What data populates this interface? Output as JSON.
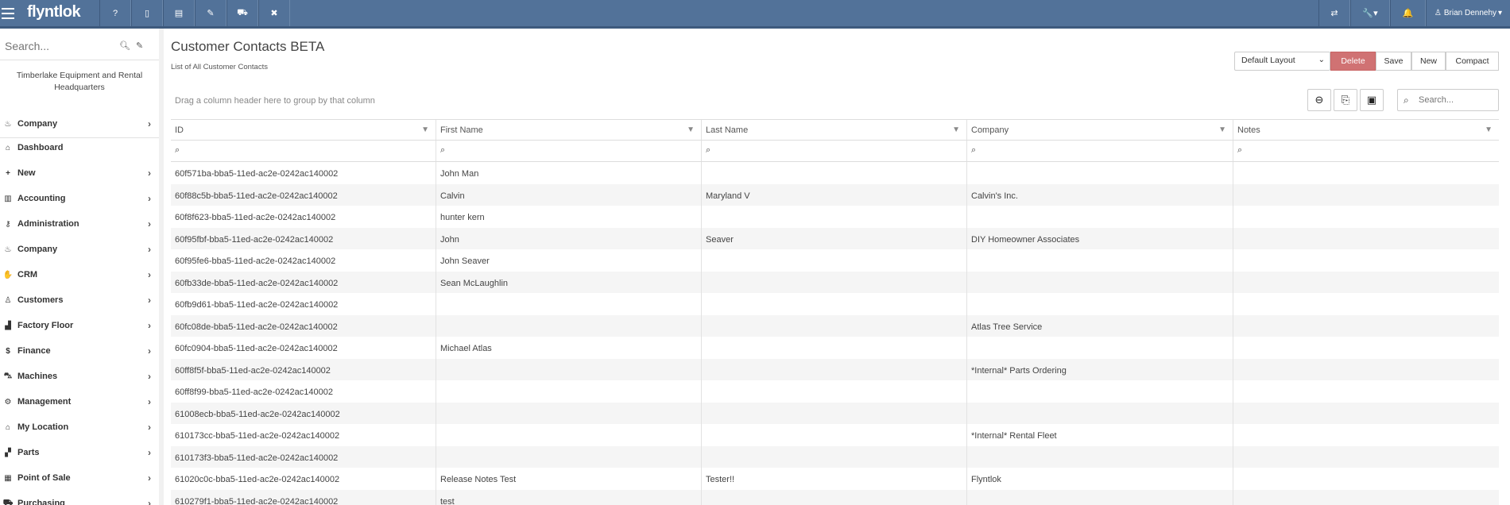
{
  "topbar": {
    "logo": "flyntlok",
    "buttons": [
      {
        "name": "help-icon",
        "glyph": "?"
      },
      {
        "name": "mobile-icon",
        "glyph": "▯"
      },
      {
        "name": "document-icon",
        "glyph": "▤"
      },
      {
        "name": "edit-document-icon",
        "glyph": "✎"
      },
      {
        "name": "cart-icon",
        "glyph": "⛟"
      },
      {
        "name": "tools-icon",
        "glyph": "✖"
      }
    ],
    "right_buttons": [
      {
        "name": "swap-icon",
        "glyph": "⇄"
      },
      {
        "name": "wrench-menu-icon",
        "glyph": "🔧▾"
      },
      {
        "name": "bell-icon",
        "glyph": "🔔"
      }
    ],
    "user_name": "Brian Dennehy"
  },
  "sidebar": {
    "search_placeholder": "Search...",
    "location": "Timberlake Equipment and Rental Headquarters",
    "company_top": "Company",
    "items": [
      {
        "label": "Dashboard",
        "icon": "home-icon",
        "glyph": "⌂",
        "chevron": false
      },
      {
        "label": "New",
        "icon": "plus-icon",
        "glyph": "+",
        "chevron": true
      },
      {
        "label": "Accounting",
        "icon": "bank-icon",
        "glyph": "▥",
        "chevron": true
      },
      {
        "label": "Administration",
        "icon": "key-icon",
        "glyph": "⚷",
        "chevron": true
      },
      {
        "label": "Company",
        "icon": "fire-icon",
        "glyph": "♨",
        "chevron": true
      },
      {
        "label": "CRM",
        "icon": "handshake-icon",
        "glyph": "✋",
        "chevron": true
      },
      {
        "label": "Customers",
        "icon": "person-icon",
        "glyph": "♙",
        "chevron": true
      },
      {
        "label": "Factory Floor",
        "icon": "factory-icon",
        "glyph": "▟",
        "chevron": true
      },
      {
        "label": "Finance",
        "icon": "dollar-icon",
        "glyph": "$",
        "chevron": true
      },
      {
        "label": "Machines",
        "icon": "tractor-icon",
        "glyph": "⛍",
        "chevron": true
      },
      {
        "label": "Management",
        "icon": "cog-icon",
        "glyph": "⚙",
        "chevron": true
      },
      {
        "label": "My Location",
        "icon": "home-icon",
        "glyph": "⌂",
        "chevron": true
      },
      {
        "label": "Parts",
        "icon": "boxes-icon",
        "glyph": "▞",
        "chevron": true
      },
      {
        "label": "Point of Sale",
        "icon": "register-icon",
        "glyph": "▦",
        "chevron": true
      },
      {
        "label": "Purchasing",
        "icon": "cart-icon",
        "glyph": "⛟",
        "chevron": true
      }
    ]
  },
  "main": {
    "title": "Customer Contacts BETA",
    "subtitle": "List of All Customer Contacts",
    "layout_select": "Default Layout",
    "buttons": {
      "delete": "Delete",
      "save": "Save",
      "new": "New",
      "compact": "Compact"
    },
    "group_hint": "Drag a column header here to group by that column",
    "grid_search_placeholder": "Search..."
  },
  "grid": {
    "columns": [
      "ID",
      "First Name",
      "Last Name",
      "Company",
      "Notes"
    ],
    "rows": [
      [
        "60f571ba-bba5-11ed-ac2e-0242ac140002",
        "John Man",
        "",
        "",
        ""
      ],
      [
        "60f88c5b-bba5-11ed-ac2e-0242ac140002",
        "Calvin",
        "Maryland V",
        "Calvin's Inc.",
        ""
      ],
      [
        "60f8f623-bba5-11ed-ac2e-0242ac140002",
        "hunter kern",
        "",
        "",
        ""
      ],
      [
        "60f95fbf-bba5-11ed-ac2e-0242ac140002",
        "John",
        "Seaver",
        "DIY Homeowner Associates",
        ""
      ],
      [
        "60f95fe6-bba5-11ed-ac2e-0242ac140002",
        "John Seaver",
        "",
        "",
        ""
      ],
      [
        "60fb33de-bba5-11ed-ac2e-0242ac140002",
        "Sean McLaughlin",
        "",
        "",
        ""
      ],
      [
        "60fb9d61-bba5-11ed-ac2e-0242ac140002",
        "",
        "",
        "",
        ""
      ],
      [
        "60fc08de-bba5-11ed-ac2e-0242ac140002",
        "",
        "",
        "Atlas Tree Service",
        ""
      ],
      [
        "60fc0904-bba5-11ed-ac2e-0242ac140002",
        "Michael Atlas",
        "",
        "",
        ""
      ],
      [
        "60ff8f5f-bba5-11ed-ac2e-0242ac140002",
        "",
        "",
        "*Internal* Parts Ordering",
        ""
      ],
      [
        "60ff8f99-bba5-11ed-ac2e-0242ac140002",
        "",
        "",
        "",
        ""
      ],
      [
        "61008ecb-bba5-11ed-ac2e-0242ac140002",
        "",
        "",
        "",
        ""
      ],
      [
        "610173cc-bba5-11ed-ac2e-0242ac140002",
        "",
        "",
        "*Internal* Rental Fleet",
        ""
      ],
      [
        "610173f3-bba5-11ed-ac2e-0242ac140002",
        "",
        "",
        "",
        ""
      ],
      [
        "61020c0c-bba5-11ed-ac2e-0242ac140002",
        "Release Notes Test",
        "Tester!!",
        "Flyntlok",
        ""
      ],
      [
        "610279f1-bba5-11ed-ac2e-0242ac140002",
        "test",
        "",
        "",
        ""
      ]
    ]
  },
  "colors": {
    "topbar": "#527299",
    "delete": "#d07273",
    "alt_row": "#f5f5f5"
  }
}
